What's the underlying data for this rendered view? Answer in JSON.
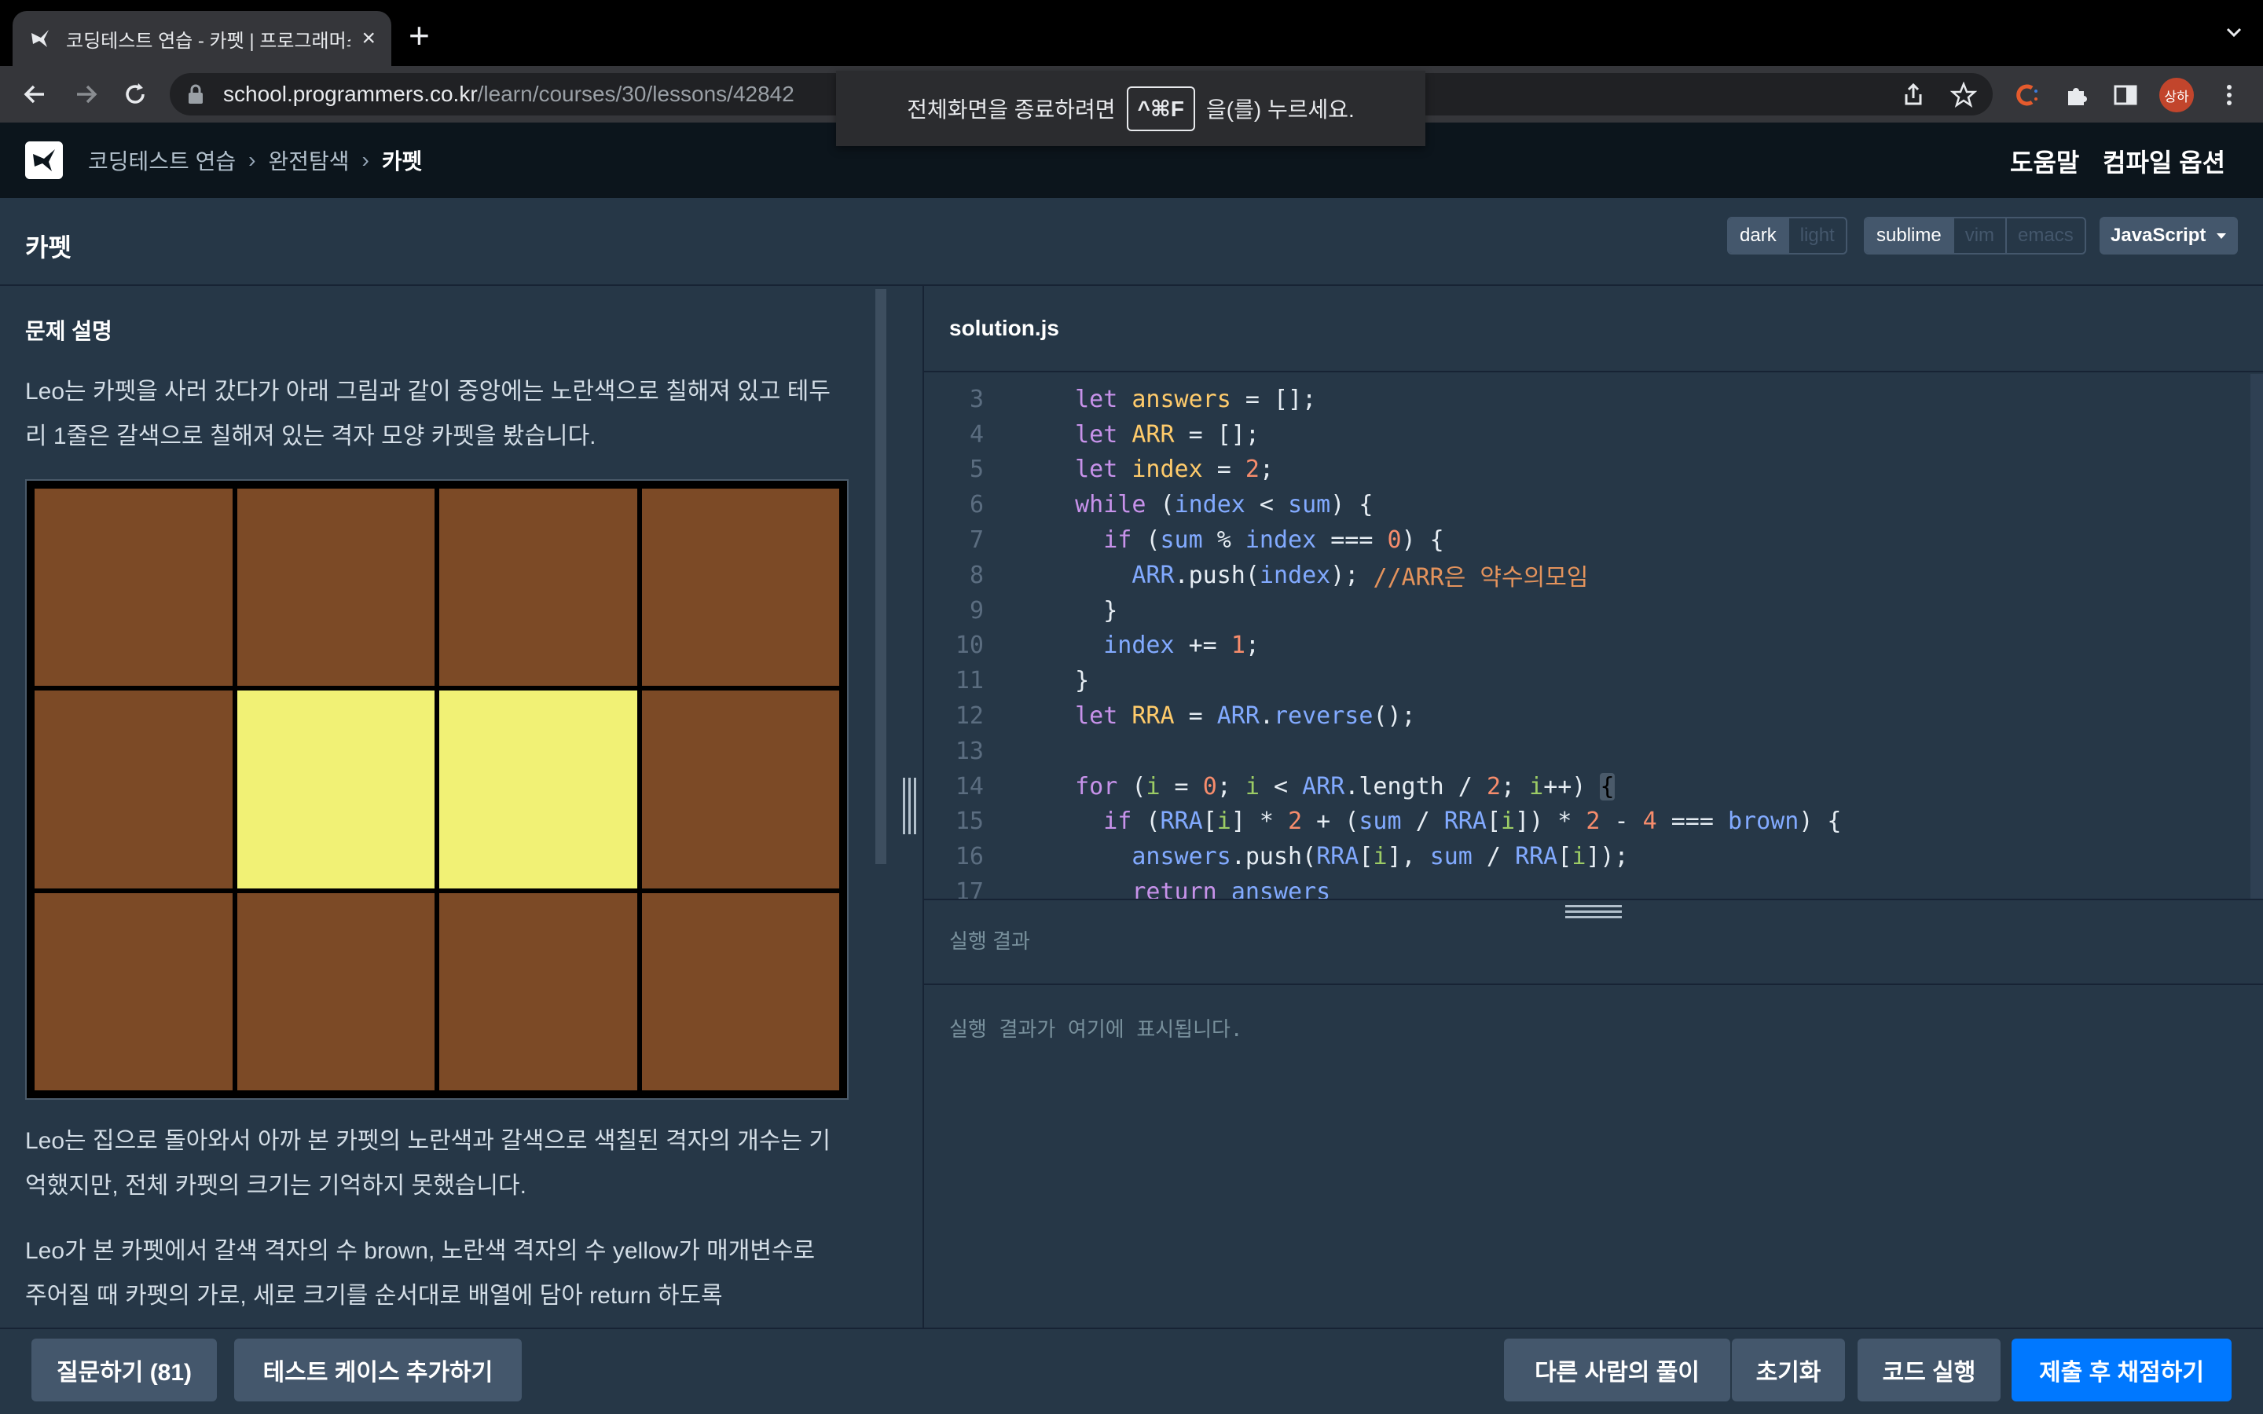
{
  "browser": {
    "tab_title": "코딩테스트 연습 - 카펫 | 프로그래머스",
    "url_host": "school.programmers.co.kr",
    "url_path": "/learn/courses/30/lessons/42842"
  },
  "toast": {
    "before": "전체화면을 종료하려면",
    "key": "^⌘F",
    "after": "을(를) 누르세요."
  },
  "avatar_label": "상하",
  "header": {
    "breadcrumbs": [
      "코딩테스트 연습",
      "완전탐색",
      "카펫"
    ],
    "help": "도움말",
    "compile_options": "컴파일 옵션"
  },
  "lesson": {
    "title": "카펫",
    "themes": [
      "dark",
      "light"
    ],
    "keymaps": [
      "sublime",
      "vim",
      "emacs"
    ],
    "language": "JavaScript"
  },
  "problem": {
    "section_title": "문제 설명",
    "p1": "Leo는 카펫을 사러 갔다가 아래 그림과 같이 중앙에는 노란색으로 칠해져 있고 테두리 1줄은 갈색으로 칠해져 있는 격자 모양 카펫을 봤습니다.",
    "p2": "Leo는 집으로 돌아와서 아까 본 카펫의 노란색과 갈색으로 색칠된 격자의 개수는 기억했지만, 전체 카펫의 크기는 기억하지 못했습니다.",
    "p3": "Leo가 본 카펫에서 갈색 격자의 수 brown, 노란색 격자의 수 yellow가 매개변수로 주어질 때 카펫의 가로, 세로 크기를 순서대로 배열에 담아 return 하도록",
    "carpet_grid": [
      [
        "brown",
        "brown",
        "brown",
        "brown"
      ],
      [
        "brown",
        "yellow",
        "yellow",
        "brown"
      ],
      [
        "brown",
        "brown",
        "brown",
        "brown"
      ]
    ],
    "colors": {
      "brown": "#7c4a26",
      "yellow": "#f1f175"
    }
  },
  "editor": {
    "file_name": "solution.js",
    "lines": [
      {
        "n": "3",
        "tokens": [
          [
            "  ",
            "tx"
          ],
          [
            "let ",
            "kw"
          ],
          [
            "answers",
            "var"
          ],
          [
            " = [];",
            "tx"
          ]
        ]
      },
      {
        "n": "4",
        "tokens": [
          [
            "  ",
            "tx"
          ],
          [
            "let ",
            "kw"
          ],
          [
            "ARR",
            "var"
          ],
          [
            " = [];",
            "tx"
          ]
        ]
      },
      {
        "n": "5",
        "tokens": [
          [
            "  ",
            "tx"
          ],
          [
            "let ",
            "kw"
          ],
          [
            "index",
            "var"
          ],
          [
            " = ",
            "tx"
          ],
          [
            "2",
            "num"
          ],
          [
            ";",
            "tx"
          ]
        ]
      },
      {
        "n": "6",
        "tokens": [
          [
            "  ",
            "tx"
          ],
          [
            "while",
            "kw"
          ],
          [
            " (",
            "tx"
          ],
          [
            "index",
            "id"
          ],
          [
            " < ",
            "tx"
          ],
          [
            "sum",
            "id"
          ],
          [
            ") {",
            "tx"
          ]
        ]
      },
      {
        "n": "7",
        "tokens": [
          [
            "    ",
            "tx"
          ],
          [
            "if",
            "kw"
          ],
          [
            " (",
            "tx"
          ],
          [
            "sum",
            "id"
          ],
          [
            " % ",
            "tx"
          ],
          [
            "index",
            "id"
          ],
          [
            " === ",
            "tx"
          ],
          [
            "0",
            "num"
          ],
          [
            ") {",
            "tx"
          ]
        ]
      },
      {
        "n": "8",
        "tokens": [
          [
            "      ",
            "tx"
          ],
          [
            "ARR",
            "id"
          ],
          [
            ".push(",
            "tx"
          ],
          [
            "index",
            "id"
          ],
          [
            "); ",
            "tx"
          ],
          [
            "//ARR은 약수의모임",
            "cm"
          ]
        ]
      },
      {
        "n": "9",
        "tokens": [
          [
            "    }",
            "tx"
          ]
        ]
      },
      {
        "n": "10",
        "tokens": [
          [
            "    ",
            "tx"
          ],
          [
            "index",
            "id"
          ],
          [
            " += ",
            "tx"
          ],
          [
            "1",
            "num"
          ],
          [
            ";",
            "tx"
          ]
        ]
      },
      {
        "n": "11",
        "tokens": [
          [
            "  }",
            "tx"
          ]
        ]
      },
      {
        "n": "12",
        "tokens": [
          [
            "  ",
            "tx"
          ],
          [
            "let ",
            "kw"
          ],
          [
            "RRA",
            "var"
          ],
          [
            " = ",
            "tx"
          ],
          [
            "ARR",
            "id"
          ],
          [
            ".",
            "tx"
          ],
          [
            "reverse",
            "id"
          ],
          [
            "();",
            "tx"
          ]
        ]
      },
      {
        "n": "13",
        "tokens": [
          [
            "",
            "tx"
          ]
        ]
      },
      {
        "n": "14",
        "tokens": [
          [
            "  ",
            "tx"
          ],
          [
            "for",
            "kw"
          ],
          [
            " (",
            "tx"
          ],
          [
            "i",
            "it"
          ],
          [
            " = ",
            "tx"
          ],
          [
            "0",
            "num"
          ],
          [
            "; ",
            "tx"
          ],
          [
            "i",
            "it"
          ],
          [
            " < ",
            "tx"
          ],
          [
            "ARR",
            "id"
          ],
          [
            ".length / ",
            "tx"
          ],
          [
            "2",
            "num"
          ],
          [
            "; ",
            "tx"
          ],
          [
            "i",
            "it"
          ],
          [
            "++) ",
            "tx"
          ],
          [
            "{",
            "br"
          ]
        ]
      },
      {
        "n": "15",
        "tokens": [
          [
            "    ",
            "tx"
          ],
          [
            "if",
            "kw"
          ],
          [
            " (",
            "tx"
          ],
          [
            "RRA",
            "id"
          ],
          [
            "[",
            "tx"
          ],
          [
            "i",
            "it"
          ],
          [
            "] * ",
            "tx"
          ],
          [
            "2",
            "num"
          ],
          [
            " + (",
            "tx"
          ],
          [
            "sum",
            "id"
          ],
          [
            " / ",
            "tx"
          ],
          [
            "RRA",
            "id"
          ],
          [
            "[",
            "tx"
          ],
          [
            "i",
            "it"
          ],
          [
            "]) * ",
            "tx"
          ],
          [
            "2",
            "num"
          ],
          [
            " - ",
            "tx"
          ],
          [
            "4",
            "num"
          ],
          [
            " === ",
            "tx"
          ],
          [
            "brown",
            "id"
          ],
          [
            ") {",
            "tx"
          ]
        ]
      },
      {
        "n": "16",
        "tokens": [
          [
            "      ",
            "tx"
          ],
          [
            "answers",
            "id"
          ],
          [
            ".push(",
            "tx"
          ],
          [
            "RRA",
            "id"
          ],
          [
            "[",
            "tx"
          ],
          [
            "i",
            "it"
          ],
          [
            "], ",
            "tx"
          ],
          [
            "sum",
            "id"
          ],
          [
            " / ",
            "tx"
          ],
          [
            "RRA",
            "id"
          ],
          [
            "[",
            "tx"
          ],
          [
            "i",
            "it"
          ],
          [
            "]);",
            "tx"
          ]
        ]
      },
      {
        "n": "17",
        "tokens": [
          [
            "      ",
            "tx"
          ],
          [
            "return",
            "kw"
          ],
          [
            " ",
            "tx"
          ],
          [
            "answers",
            "id"
          ]
        ]
      }
    ]
  },
  "result": {
    "label": "실행 결과",
    "placeholder": "실행 결과가 여기에 표시됩니다."
  },
  "footer": {
    "ask": "질문하기 (81)",
    "add_testcase": "테스트 케이스 추가하기",
    "others": "다른 사람의 풀이",
    "reset": "초기화",
    "run": "코드 실행",
    "submit": "제출 후 채점하기"
  }
}
